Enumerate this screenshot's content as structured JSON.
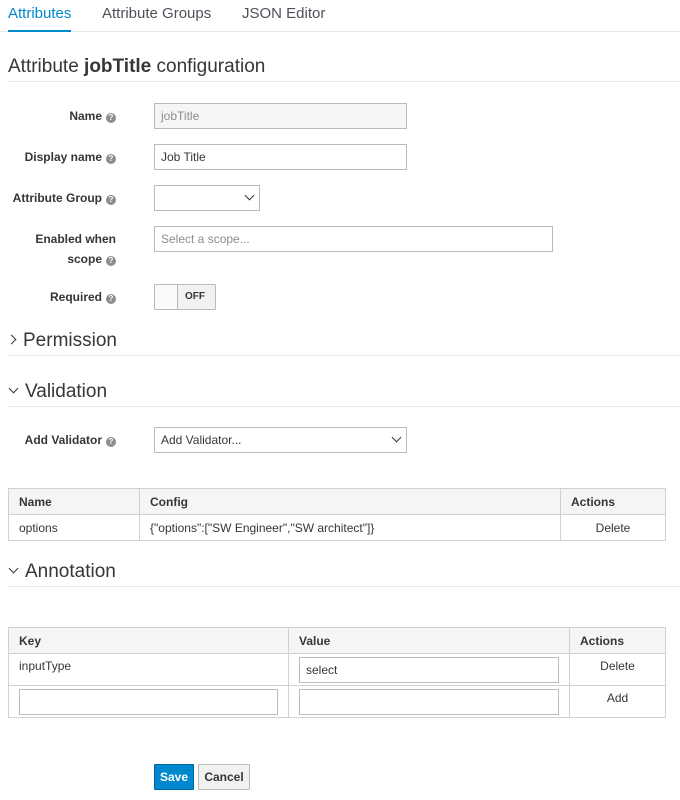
{
  "tabs": [
    {
      "label": "Attributes",
      "active": true
    },
    {
      "label": "Attribute Groups",
      "active": false
    },
    {
      "label": "JSON Editor",
      "active": false
    }
  ],
  "title": {
    "prefix": "Attribute ",
    "name": "jobTitle",
    "suffix": " configuration"
  },
  "form": {
    "name": {
      "label": "Name",
      "value": "jobTitle"
    },
    "display_name": {
      "label": "Display name",
      "value": "Job Title"
    },
    "attribute_group": {
      "label": "Attribute Group",
      "value": ""
    },
    "enabled_when": {
      "label_line1": "Enabled when",
      "label_line2": "scope",
      "placeholder": "Select a scope..."
    },
    "required": {
      "label": "Required",
      "state": "OFF"
    }
  },
  "sections": {
    "permission": "Permission",
    "validation": "Validation",
    "annotation": "Annotation"
  },
  "validation": {
    "add_label": "Add Validator",
    "add_placeholder": "Add Validator...",
    "columns": [
      "Name",
      "Config",
      "Actions"
    ],
    "rows": [
      {
        "name": "options",
        "config": "{\"options\":[\"SW Engineer\",\"SW architect\"]}",
        "action": "Delete"
      }
    ]
  },
  "annotation": {
    "columns": [
      "Key",
      "Value",
      "Actions"
    ],
    "rows": [
      {
        "key": "inputType",
        "value": "select",
        "action": "Delete"
      }
    ],
    "new_row": {
      "key": "",
      "value": "",
      "action": "Add"
    }
  },
  "buttons": {
    "save": "Save",
    "cancel": "Cancel"
  },
  "colors": {
    "accent": "#0088ce",
    "text": "#363636",
    "border": "#d1d1d1"
  }
}
